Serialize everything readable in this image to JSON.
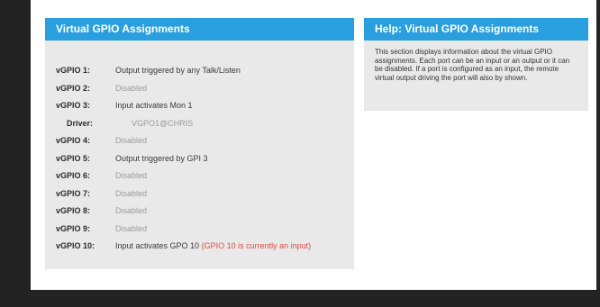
{
  "left_panel": {
    "title": "Virtual GPIO Assignments",
    "rows": [
      {
        "label": "vGPIO 1:",
        "value": "Output triggered by any Talk/Listen",
        "state": "active"
      },
      {
        "label": "vGPIO 2:",
        "value": "Disabled",
        "state": "disabled"
      },
      {
        "label": "vGPIO 3:",
        "value": "Input activates Mon 1",
        "state": "active"
      },
      {
        "label": "Driver:",
        "value": "VGPO1@CHRIS",
        "state": "driver"
      },
      {
        "label": "vGPIO 4:",
        "value": "Disabled",
        "state": "disabled"
      },
      {
        "label": "vGPIO 5:",
        "value": "Output triggered by GPI 3",
        "state": "active"
      },
      {
        "label": "vGPIO 6:",
        "value": "Disabled",
        "state": "disabled"
      },
      {
        "label": "vGPIO 7:",
        "value": "Disabled",
        "state": "disabled"
      },
      {
        "label": "vGPIO 8:",
        "value": "Disabled",
        "state": "disabled"
      },
      {
        "label": "vGPIO 9:",
        "value": "Disabled",
        "state": "disabled"
      },
      {
        "label": "vGPIO 10:",
        "value": "Input activates GPO 10",
        "note": "(GPIO 10 is currently an input)",
        "state": "active"
      }
    ]
  },
  "right_panel": {
    "title": "Help: Virtual GPIO Assignments",
    "text": "This section displays information about the virtual GPIO assignments. Each port can be an input or an output or it can be disabled. If a port is configured as an input, the remote virtual output driving the port will also by shown."
  },
  "colors": {
    "header_blue": "#2a9fe0",
    "panel_grey": "#e9e9e9",
    "warning_red": "#e24a3c",
    "background_dark": "#232323"
  }
}
